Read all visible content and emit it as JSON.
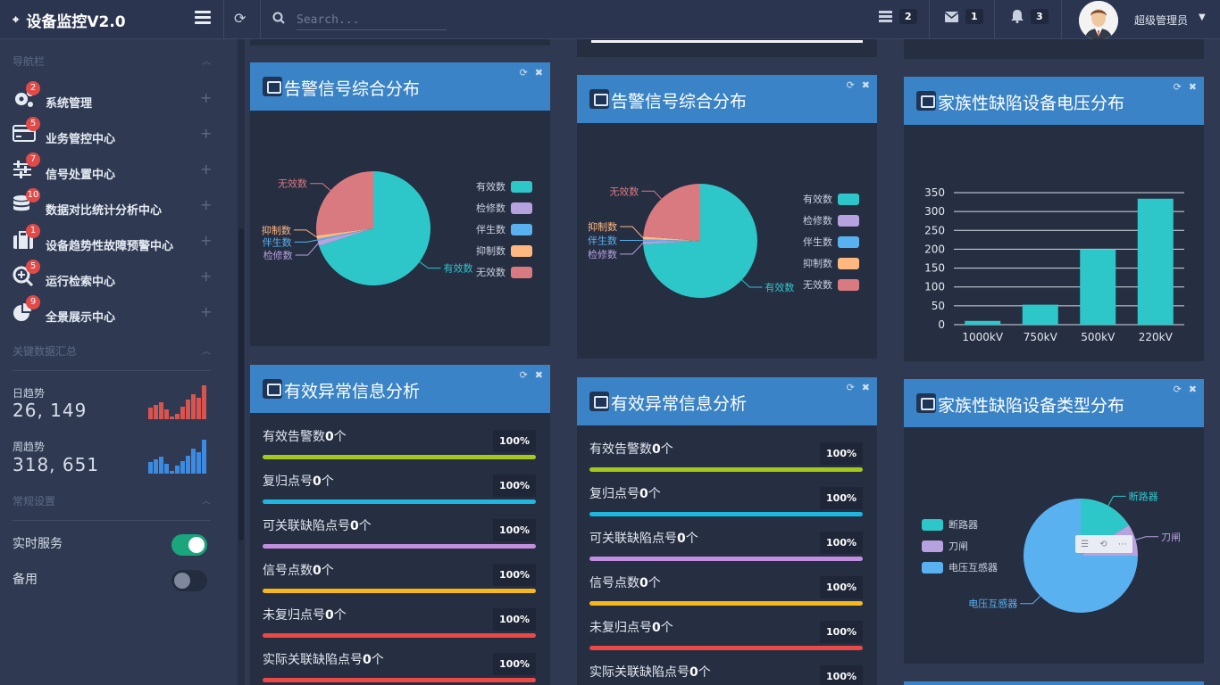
{
  "app": {
    "title": "设备监控V2.0"
  },
  "search": {
    "placeholder": "Search..."
  },
  "topbar": {
    "tasks": {
      "icon": "list-icon",
      "count": "2"
    },
    "messages": {
      "icon": "envelope-icon",
      "count": "1"
    },
    "notifications": {
      "icon": "bell-icon",
      "count": "3"
    },
    "user": {
      "name": "超级管理员"
    }
  },
  "sidebar": {
    "nav_title": "导航栏",
    "items": [
      {
        "label": "系统管理",
        "badge": "2",
        "icon": "gears-icon"
      },
      {
        "label": "业务管控中心",
        "badge": "5",
        "icon": "credit-card-icon"
      },
      {
        "label": "信号处置中心",
        "badge": "7",
        "icon": "sliders-icon"
      },
      {
        "label": "数据对比统计分析中心",
        "badge": "10",
        "icon": "database-icon"
      },
      {
        "label": "设备趋势性故障预警中心",
        "badge": "1",
        "icon": "briefcase-icon"
      },
      {
        "label": "运行检索中心",
        "badge": "5",
        "icon": "zoom-in-icon"
      },
      {
        "label": "全景展示中心",
        "badge": "9",
        "icon": "pie-chart-icon"
      }
    ],
    "key_data_title": "关键数据汇总",
    "daily": {
      "label": "日趋势",
      "value": "26, 149"
    },
    "weekly": {
      "label": "周趋势",
      "value": "318, 651"
    },
    "settings_title": "常规设置",
    "settings": [
      {
        "label": "实时服务",
        "on": true
      },
      {
        "label": "备用",
        "on": false
      }
    ]
  },
  "panels": {
    "alarm_title": "告警信号综合分布",
    "abnormal_title": "有效异常信息分析",
    "voltage_title": "家族性缺陷设备电压分布",
    "type_title": "家族性缺陷设备类型分布"
  },
  "abnormal_rows": [
    {
      "label": "有效告警数",
      "count": "0",
      "unit": "个",
      "pct": "100%",
      "color": "#a4c91a"
    },
    {
      "label": "复归点号",
      "count": "0",
      "unit": "个",
      "pct": "100%",
      "color": "#1fb6df"
    },
    {
      "label": "可关联缺陷点号",
      "count": "0",
      "unit": "个",
      "pct": "100%",
      "color": "#c28fe0"
    },
    {
      "label": "信号点数",
      "count": "0",
      "unit": "个",
      "pct": "100%",
      "color": "#f6b81a"
    },
    {
      "label": "未复归点号",
      "count": "0",
      "unit": "个",
      "pct": "100%",
      "color": "#ec4846"
    },
    {
      "label": "实际关联缺陷点号",
      "count": "0",
      "unit": "个",
      "pct": "100%",
      "color": "#ec4846"
    }
  ],
  "chart_data": [
    {
      "type": "pie",
      "legend": [
        "有效数",
        "检修数",
        "伴生数",
        "抑制数",
        "无效数"
      ],
      "values": [
        70,
        1.5,
        0.5,
        1,
        27
      ],
      "colors": [
        "#2ec7c9",
        "#b6a2de",
        "#5ab1ef",
        "#ffb980",
        "#d87a80"
      ],
      "legend_position": "right"
    },
    {
      "type": "pie",
      "legend": [
        "有效数",
        "检修数",
        "伴生数",
        "抑制数",
        "无效数"
      ],
      "values": [
        74,
        0.8,
        0.6,
        0.8,
        23.8
      ],
      "colors": [
        "#2ec7c9",
        "#b6a2de",
        "#5ab1ef",
        "#ffb980",
        "#d87a80"
      ],
      "legend_position": "right"
    },
    {
      "type": "bar",
      "categories": [
        "1000kV",
        "750kV",
        "500kV",
        "220kV"
      ],
      "values": [
        10,
        53,
        200,
        334
      ],
      "ylim": [
        0,
        350
      ],
      "yticks": [
        "0",
        "50",
        "100",
        "150",
        "200",
        "250",
        "300",
        "350"
      ],
      "grid": true,
      "color": "#2ec7c9"
    },
    {
      "type": "pie",
      "legend": [
        "断路器",
        "刀闸",
        "电压互感器"
      ],
      "values": [
        16,
        9,
        75
      ],
      "colors": [
        "#2ec7c9",
        "#b6a2de",
        "#5ab1ef"
      ],
      "legend_position": "left"
    }
  ]
}
